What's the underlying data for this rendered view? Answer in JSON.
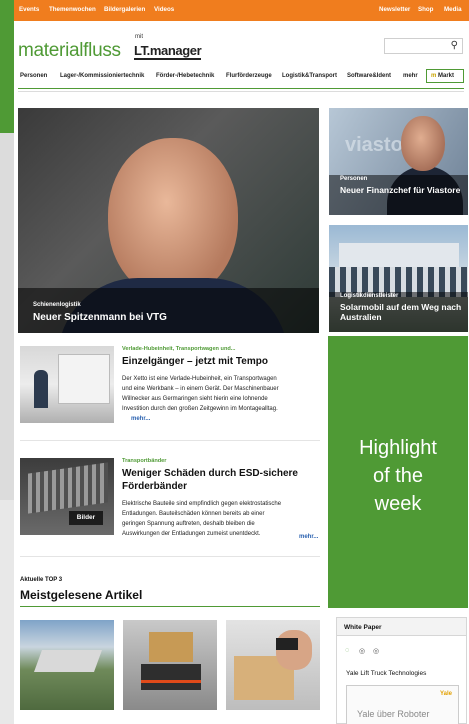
{
  "topbar": {
    "left": [
      "Events",
      "Themenwochen",
      "Bildergalerien",
      "Videos"
    ],
    "right": [
      "Newsletter",
      "Shop",
      "Media"
    ]
  },
  "logo": {
    "main": "materialfluss",
    "mit": "mit",
    "lt": "LT.manager"
  },
  "search": {
    "placeholder": "",
    "icon": "search-icon"
  },
  "nav": {
    "items": [
      "Personen",
      "Lager-/Kommissioniertechnik",
      "Förder-/Hebetechnik",
      "Flurförderzeuge",
      "Logistik&Transport",
      "Software&Ident",
      "mehr"
    ],
    "markt": "Markt"
  },
  "hero": {
    "category": "Schienenlogistik",
    "title": "Neuer Spitzenmann bei VTG"
  },
  "side": [
    {
      "brand": "viasto",
      "category": "Personen",
      "title": "Neuer Finanzchef für Viastore"
    },
    {
      "category": "Logistikdienstleister",
      "title": "Solarmobil auf dem Weg nach Australien"
    }
  ],
  "articles": [
    {
      "category": "Verlade-Hubeinheit, Transportwagen und...",
      "title": "Einzelgänger – jetzt mit Tempo",
      "lines": [
        "Der Xetto ist eine Verlade-Hubeinheit, ein Transportwagen",
        "und eine Werkbank – in einem Gerät. Der Maschinenbauer",
        "Willnecker aus Germaringen sieht hierin eine lohnende",
        "Investition durch den großen Zeitgewinn im Montagealltag."
      ],
      "more": "mehr..."
    },
    {
      "category": "Transportbänder",
      "title_lines": [
        "Weniger Schäden durch ESD-sichere",
        "Förderbänder"
      ],
      "lines": [
        "Elektrische Bauteile sind empfindlich gegen elektrostatische",
        "Entladungen. Bauteilschäden können bereits ab einer",
        "geringen Spannung auftreten, deshalb bleiben die",
        "Auswirkungen der Entladungen zumeist unentdeckt."
      ],
      "more": "mehr...",
      "badge": "Bilder"
    }
  ],
  "highlight": {
    "lines": [
      "Highlight",
      "of the",
      "week"
    ]
  },
  "top3": {
    "label": "Aktuelle TOP 3",
    "title": "Meistgelesene Artikel"
  },
  "whitepaper": {
    "header": "White Paper",
    "company": "Yale Lift Truck Technologies",
    "preview_brand": "Yale",
    "preview_text": "Yale über Roboter"
  },
  "colors": {
    "green": "#4f9a35",
    "orange": "#f07d1e",
    "link": "#2b62b0"
  }
}
